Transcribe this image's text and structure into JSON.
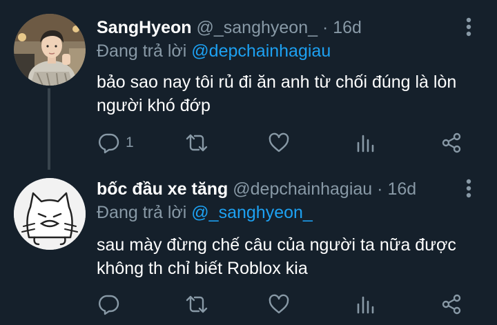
{
  "tweets": [
    {
      "name": "SangHyeon",
      "handle": "@_sanghyeon_",
      "separator": "·",
      "time": "16d",
      "reply_prefix": "Đang trả lời",
      "reply_to": "@depchainhagiau",
      "text": "bảo sao nay tôi rủ đi ăn anh từ chối đúng là lòn người khó đớp",
      "reply_count": "1",
      "avatar_icon": "profile-photo"
    },
    {
      "name": "bốc đầu xe tăng",
      "handle": "@depchainhagiau",
      "separator": "·",
      "time": "16d",
      "reply_prefix": "Đang trả lời",
      "reply_to": "@_sanghyeon_",
      "text": "sau mày đừng chế câu của người ta nữa được không th chỉ biết Roblox kia",
      "reply_count": "",
      "avatar_icon": "cartoon-cat-avatar"
    }
  ],
  "icons": {
    "more": "more-vertical-icon",
    "reply": "reply-icon",
    "retweet": "retweet-icon",
    "like": "heart-icon",
    "stats": "stats-icon",
    "share": "share-icon"
  },
  "colors": {
    "background": "#15202b",
    "secondary_text": "#8899a6",
    "link": "#1da1f2",
    "divider": "#38444d"
  }
}
